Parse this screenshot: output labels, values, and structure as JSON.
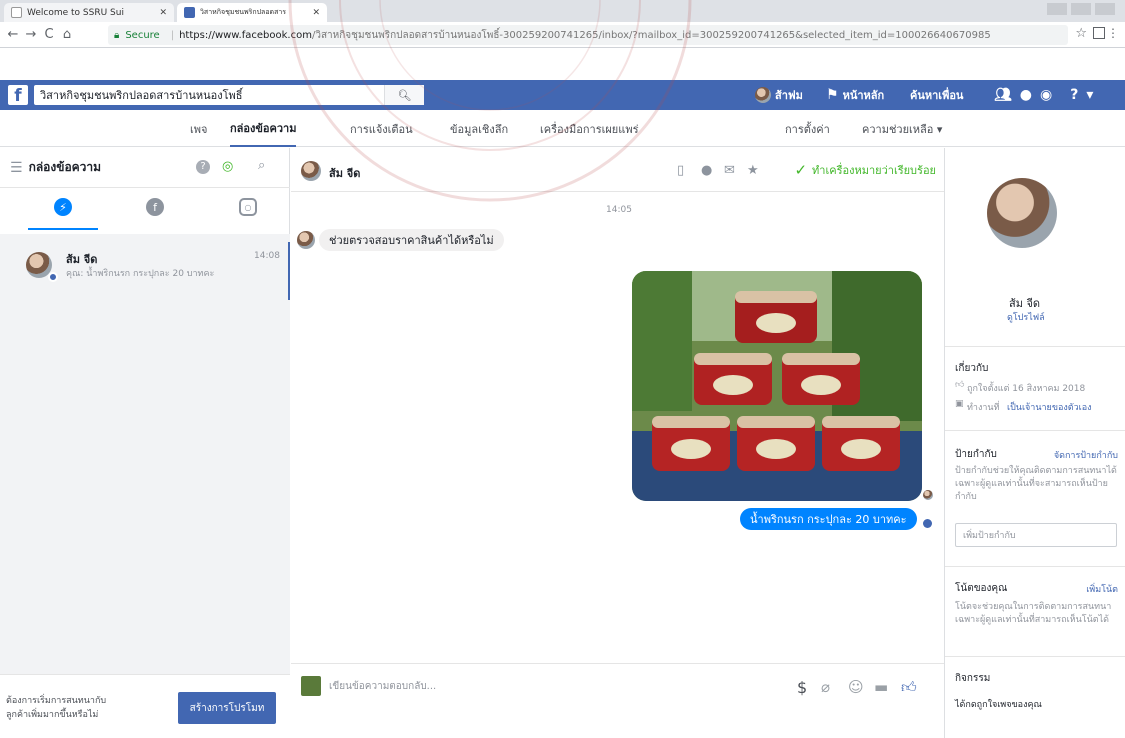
{
  "browser": {
    "tabs": [
      {
        "label": "Welcome to SSRU Sui",
        "close": "✕"
      },
      {
        "label": "วิสาหกิจชุมชนพริกปลอดสาร",
        "close": "✕"
      }
    ],
    "secure_label": "Secure",
    "url_host": "https://www.facebook.com",
    "url_path": "/วิสาหกิจชุมชนพริกปลอดสารบ้านหนองโพธิ์-300259200741265/inbox/?mailbox_id=300259200741265&selected_item_id=100026640670985"
  },
  "fbbar": {
    "logo": "f",
    "search_value": "วิสาหกิจชุมชนพริกปลอดสารบ้านหนองโพธิ์",
    "user_name": "ส้าฟม",
    "home": "หน้าหลัก",
    "find_friends": "ค้นหาเพื่อน"
  },
  "pagemenu": {
    "items": [
      "เพจ",
      "กล่องข้อความ",
      "การแจ้งเตือน",
      "ข้อมูลเชิงลึก",
      "เครื่องมือการเผยแพร่"
    ],
    "settings": "การตั้งค่า",
    "help": "ความช่วยเหลือ ▾"
  },
  "inbox": {
    "title": "กล่องข้อความ",
    "conversation": {
      "name": "ส้ม จีด",
      "time": "14:08",
      "snippet": "คุณ: น้ำพริกนรก กระปุกละ 20 บาทคะ"
    },
    "footer_text_1": "ต้องการเริ่มการสนทนากับ",
    "footer_text_2": "ลูกค้าเพิ่มมากขึ้นหรือไม่",
    "promo_button": "สร้างการโปรโมท"
  },
  "chat": {
    "contact_name": "ส้ม จีด",
    "mark_done": "ทำเครื่องหมายว่าเรียบร้อย",
    "timestamp": "14:05",
    "incoming_message": "ช่วยตรวจสอบราคาสินค้าได้หรือไม่",
    "outgoing_message": "น้ำพริกนรก กระปุกละ 20 บาทคะ",
    "composer_placeholder": "เขียนข้อความตอบกลับ..."
  },
  "profile": {
    "name": "ส้ม จีด",
    "view_profile": "ดูโปรไฟล์",
    "about_title": "เกี่ยวกับ",
    "liked_since": "ถูกใจตั้งแต่ 16 สิงหาคม 2018",
    "works_at_prefix": "ทำงานที่",
    "works_at_link": "เป็นเจ้านายของตัวเอง",
    "labels_title": "ป้ายกำกับ",
    "labels_manage": "จัดการป้ายกำกับ",
    "labels_desc": "ป้ายกำกับช่วยให้คุณติดตามการสนทนาได้ เฉพาะผู้ดูแลเท่านั้นที่จะสามารถเห็นป้ายกำกับ",
    "labels_input_placeholder": "เพิ่มป้ายกำกับ",
    "notes_title": "โน้ตของคุณ",
    "notes_add": "เพิ่มโน้ต",
    "notes_desc": "โน้ตจะช่วยคุณในการติดตามการสนทนา เฉพาะผู้ดูแลเท่านั้นที่สามารถเห็นโน้ตได้",
    "activity_title": "กิจกรรม",
    "activity_item": "ได้กดถูกใจเพจของคุณ"
  },
  "colors": {
    "facebook_blue": "#4267b2",
    "messenger_blue": "#0084ff",
    "done_green": "#42b72a"
  }
}
